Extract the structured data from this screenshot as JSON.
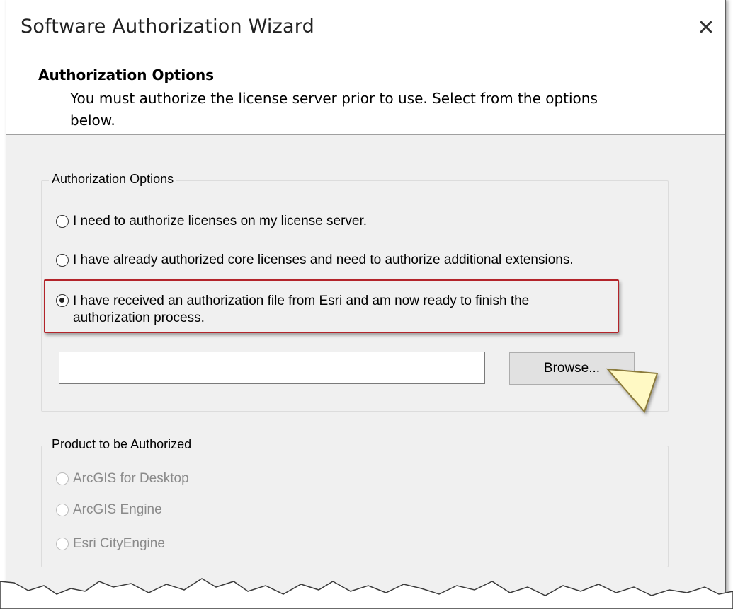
{
  "window": {
    "title": "Software Authorization Wizard",
    "close_glyph": "✕"
  },
  "header": {
    "title": "Authorization Options",
    "description": "You must authorize the license server prior to use. Select from the options below."
  },
  "authorization_options": {
    "group_label": "Authorization Options",
    "options": [
      {
        "label": "I need to authorize licenses on my license server.",
        "checked": false
      },
      {
        "label": "I have already authorized core licenses and need to authorize additional extensions.",
        "checked": false
      },
      {
        "label": "I have received an authorization file from Esri and am now ready to finish the authorization process.",
        "checked": true
      }
    ],
    "file_path_value": "",
    "browse_label": "Browse..."
  },
  "product": {
    "group_label": "Product to be Authorized",
    "options": [
      {
        "label": "ArcGIS for Desktop",
        "enabled": false
      },
      {
        "label": "ArcGIS Engine",
        "enabled": false
      },
      {
        "label": "Esri CityEngine",
        "enabled": false
      }
    ]
  },
  "icons": {
    "close": "close-icon",
    "callout_pointer": "pointer-arrow-icon"
  },
  "colors": {
    "highlight_border": "#b3242a",
    "pointer_fill": "#fff9c4",
    "dialog_background": "#f0f0f0"
  }
}
